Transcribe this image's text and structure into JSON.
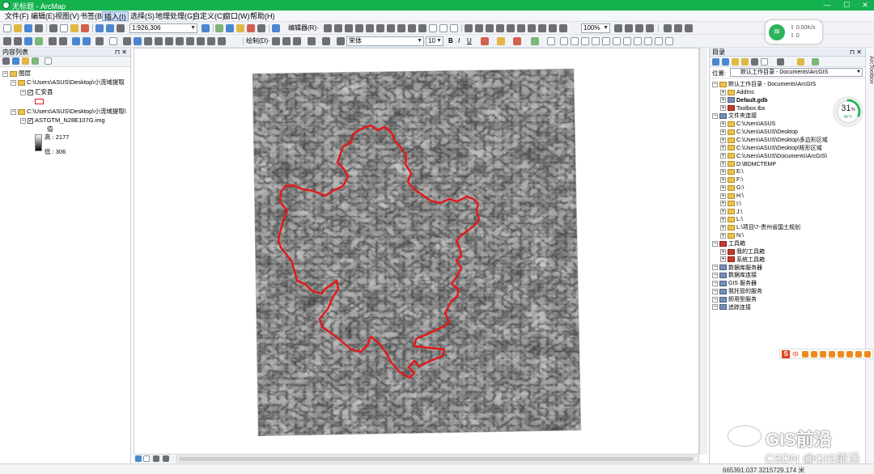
{
  "window": {
    "title": "无标题 - ArcMap",
    "controls": [
      "—",
      "☐",
      "✕"
    ],
    "title_bar_color": "#16b14f"
  },
  "menu": {
    "items": [
      "文件(F)",
      "编辑(E)",
      "视图(V)",
      "书签(B)",
      "插入(I)",
      "选择(S)",
      "地理处理(G)",
      "自定义(C)",
      "窗口(W)",
      "帮助(H)"
    ],
    "active_index": 4
  },
  "toolbar": {
    "scale": "1:926,306",
    "editor_label": "编辑器(R)·",
    "drawing_label": "绘制(D)·",
    "font_name": "宋体",
    "font_size": "10",
    "bold": "B",
    "italic": "I",
    "underline": "U",
    "zoom_percent": "100%"
  },
  "toc": {
    "title": "内容列表",
    "layers_root": "图层",
    "group1_path": "C:\\Users\\ASUS\\Desktop\\小流域提取",
    "layer1_name": "汇安县",
    "group2_path": "C:\\Users\\ASUS\\Desktop\\小流域提取\\",
    "layer2_name": "ASTGTM_N28E107G.img",
    "legend_value_label": "值",
    "legend_high": "高 : 2177",
    "legend_low": "低 : 306"
  },
  "catalog": {
    "title": "目录",
    "location_label": "位置:",
    "location_value": "默认工作目录 - Documents\\ArcGIS",
    "items": [
      {
        "label": "默认工作目录 - Documents\\ArcGIS",
        "level": 0,
        "bold": false
      },
      {
        "label": "AddIns",
        "level": 1,
        "bold": false
      },
      {
        "label": "Default.gdb",
        "level": 1,
        "bold": true
      },
      {
        "label": "Toolbox.tbx",
        "level": 1,
        "bold": false
      },
      {
        "label": "文件夹连接",
        "level": 0,
        "bold": false
      },
      {
        "label": "C:\\Users\\ASUS",
        "level": 1,
        "bold": false
      },
      {
        "label": "C:\\Users\\ASUS\\Desktop",
        "level": 1,
        "bold": false
      },
      {
        "label": "C:\\Users\\ASUS\\Desktop\\多边形区域",
        "level": 1,
        "bold": false
      },
      {
        "label": "C:\\Users\\ASUS\\Desktop\\矩形区域",
        "level": 1,
        "bold": false
      },
      {
        "label": "C:\\Users\\ASUS\\Documents\\ArcGIS\\",
        "level": 1,
        "bold": false
      },
      {
        "label": "D:\\BDMCTEMP",
        "level": 1,
        "bold": false
      },
      {
        "label": "E:\\",
        "level": 1,
        "bold": false
      },
      {
        "label": "F:\\",
        "level": 1,
        "bold": false
      },
      {
        "label": "G:\\",
        "level": 1,
        "bold": false
      },
      {
        "label": "H:\\",
        "level": 1,
        "bold": false
      },
      {
        "label": "I:\\",
        "level": 1,
        "bold": false
      },
      {
        "label": "J:\\",
        "level": 1,
        "bold": false
      },
      {
        "label": "L:\\",
        "level": 1,
        "bold": false
      },
      {
        "label": "L:\\项目\\7-贵州省国土规划",
        "level": 1,
        "bold": false
      },
      {
        "label": "N:\\",
        "level": 1,
        "bold": false
      },
      {
        "label": "工具箱",
        "level": 0,
        "bold": false
      },
      {
        "label": "我的工具箱",
        "level": 1,
        "bold": false
      },
      {
        "label": "系统工具箱",
        "level": 1,
        "bold": false
      },
      {
        "label": "数据库服务器",
        "level": 0,
        "bold": false
      },
      {
        "label": "数据库连接",
        "level": 0,
        "bold": false
      },
      {
        "label": "GIS 服务器",
        "level": 0,
        "bold": false
      },
      {
        "label": "我托管的服务",
        "level": 0,
        "bold": false
      },
      {
        "label": "即用型服务",
        "level": 0,
        "bold": false
      },
      {
        "label": "追踪连接",
        "level": 0,
        "bold": false
      }
    ]
  },
  "side_tab": "ArcToolbox",
  "network_widget": {
    "upload": "0.00K/s",
    "download": "0"
  },
  "cpu_gauge": {
    "percent": "31",
    "unit": "%",
    "temperature": "49℃"
  },
  "status": {
    "coordinates": "665391.037  3215729.174 米"
  },
  "ime_bar": {
    "mode": "中"
  },
  "watermarks": {
    "brand": "GIS前沿",
    "csdn": "CSDN @GIS前沿"
  },
  "map": {
    "boundary_color": "#e41818",
    "dem_light": "#f5f5f5",
    "dem_dark": "#1b1b1b"
  }
}
